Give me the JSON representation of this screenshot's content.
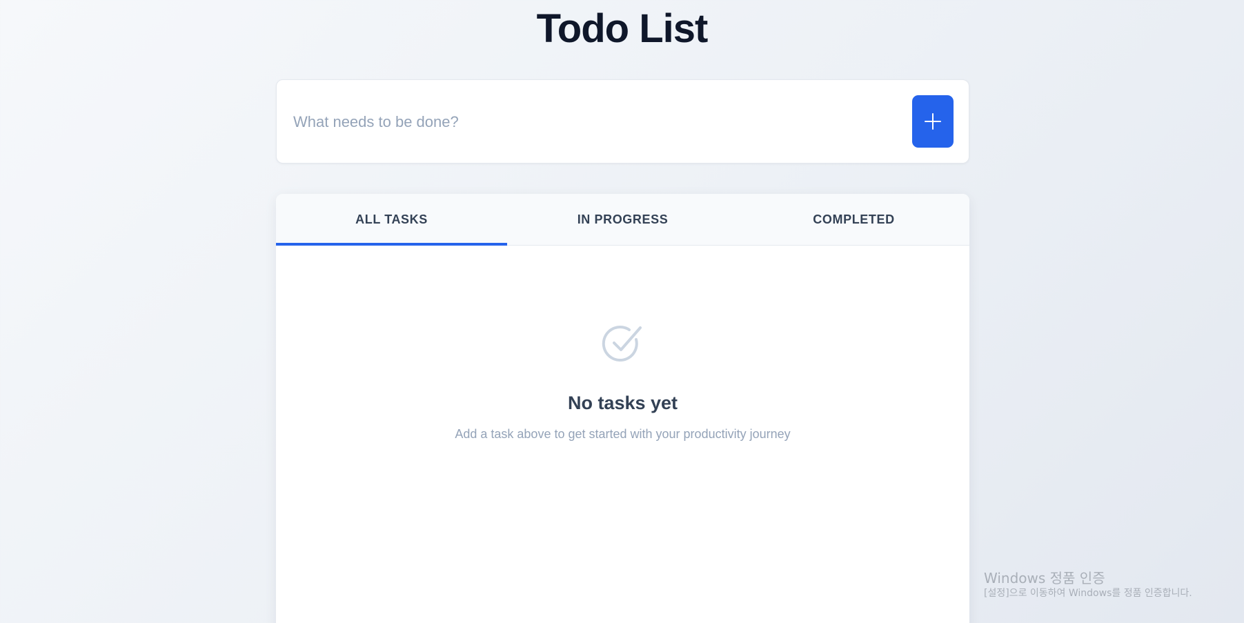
{
  "header": {
    "title": "Todo List"
  },
  "add_task": {
    "placeholder": "What needs to be done?",
    "value": "",
    "button_icon": "plus-icon"
  },
  "tabs": [
    {
      "label": "ALL TASKS",
      "active": true
    },
    {
      "label": "IN PROGRESS",
      "active": false
    },
    {
      "label": "COMPLETED",
      "active": false
    }
  ],
  "empty_state": {
    "icon": "check-circle-icon",
    "title": "No tasks yet",
    "subtitle": "Add a task above to get started with your productivity journey"
  },
  "watermark": {
    "title": "Windows 정품 인증",
    "subtitle": "[설정]으로 이동하여 Windows를 정품 인증합니다."
  },
  "colors": {
    "accent": "#2563eb",
    "heading": "#0f172a",
    "text": "#334155",
    "muted": "#94a3b8",
    "icon_muted": "#cbd5e1"
  }
}
